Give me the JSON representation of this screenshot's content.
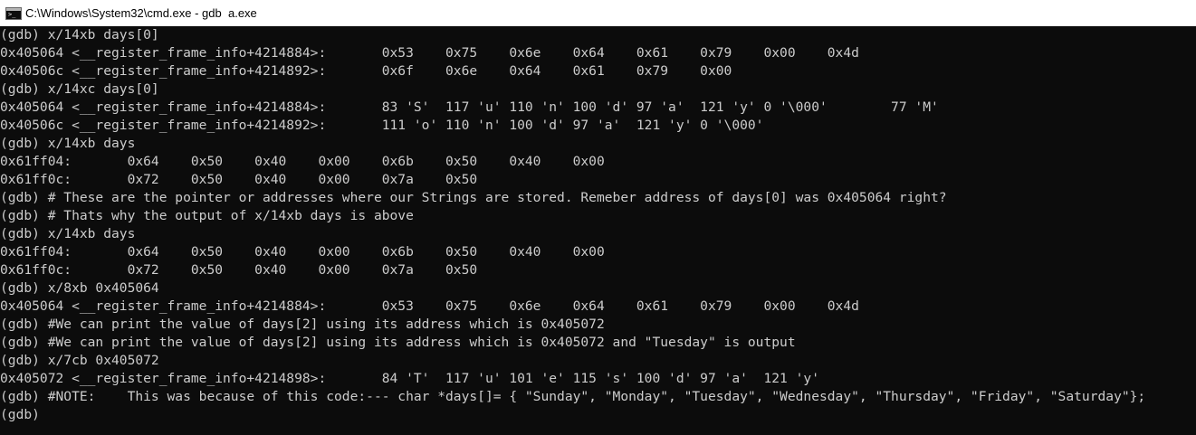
{
  "window": {
    "title": "C:\\Windows\\System32\\cmd.exe - gdb  a.exe",
    "icon": "cmd-console-icon",
    "icon_text": ">_"
  },
  "console": {
    "lines": [
      "(gdb) x/14xb days[0]",
      "0x405064 <__register_frame_info+4214884>:       0x53    0x75    0x6e    0x64    0x61    0x79    0x00    0x4d",
      "0x40506c <__register_frame_info+4214892>:       0x6f    0x6e    0x64    0x61    0x79    0x00",
      "(gdb) x/14xc days[0]",
      "0x405064 <__register_frame_info+4214884>:       83 'S'  117 'u' 110 'n' 100 'd' 97 'a'  121 'y' 0 '\\000'        77 'M'",
      "0x40506c <__register_frame_info+4214892>:       111 'o' 110 'n' 100 'd' 97 'a'  121 'y' 0 '\\000'",
      "(gdb) x/14xb days",
      "0x61ff04:       0x64    0x50    0x40    0x00    0x6b    0x50    0x40    0x00",
      "0x61ff0c:       0x72    0x50    0x40    0x00    0x7a    0x50",
      "(gdb) # These are the pointer or addresses where our Strings are stored. Remeber address of days[0] was 0x405064 right?",
      "(gdb) # Thats why the output of x/14xb days is above",
      "(gdb) x/14xb days",
      "0x61ff04:       0x64    0x50    0x40    0x00    0x6b    0x50    0x40    0x00",
      "0x61ff0c:       0x72    0x50    0x40    0x00    0x7a    0x50",
      "(gdb) x/8xb 0x405064",
      "0x405064 <__register_frame_info+4214884>:       0x53    0x75    0x6e    0x64    0x61    0x79    0x00    0x4d",
      "(gdb) #We can print the value of days[2] using its address which is 0x405072",
      "(gdb) #We can print the value of days[2] using its address which is 0x405072 and \"Tuesday\" is output",
      "(gdb) x/7cb 0x405072",
      "0x405072 <__register_frame_info+4214898>:       84 'T'  117 'u' 101 'e' 115 's' 100 'd' 97 'a'  121 'y'",
      "(gdb) #NOTE:    This was because of this code:--- char *days[]= { \"Sunday\", \"Monday\", \"Tuesday\", \"Wednesday\", \"Thursday\", \"Friday\", \"Saturday\"};",
      "(gdb)"
    ]
  },
  "colors": {
    "console_background": "#0c0c0c",
    "console_text": "#cccccc",
    "titlebar_background": "#ffffff",
    "titlebar_text": "#000000"
  }
}
